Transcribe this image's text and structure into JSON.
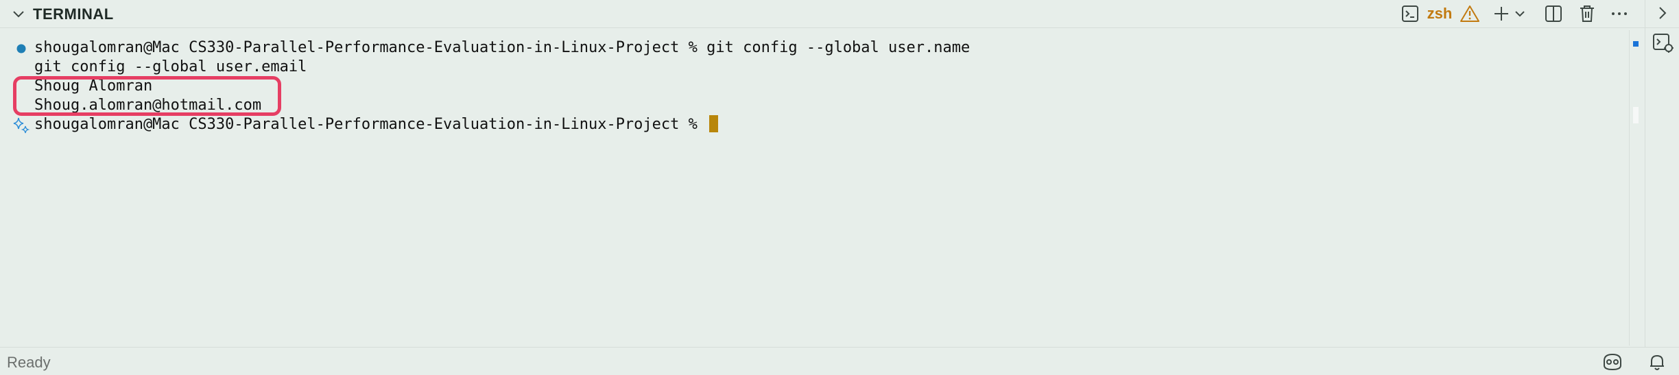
{
  "header": {
    "title": "TERMINAL",
    "shell_name": "zsh"
  },
  "terminal": {
    "lines": [
      {
        "text": "shougalomran@Mac CS330-Parallel-Performance-Evaluation-in-Linux-Project % git config --global user.name",
        "marker": "command-dot"
      },
      {
        "text": "git config --global user.email"
      },
      {
        "text": "Shoug Alomran"
      },
      {
        "text": "Shoug.alomran@hotmail.com"
      },
      {
        "text": "shougalomran@Mac CS330-Parallel-Performance-Evaluation-in-Linux-Project % ",
        "marker": "sparkle",
        "cursor": true
      }
    ]
  },
  "statusbar": {
    "status": "Ready"
  },
  "colors": {
    "background": "#e7eeea",
    "shell_accent": "#c27a10",
    "cursor": "#b8860b",
    "highlight_box": "#e63e63",
    "command_dot": "#1f7fb5",
    "sparkle": "#2f8fd8"
  },
  "icons": [
    "chevron-down-icon",
    "terminal-icon",
    "warning-icon",
    "plus-icon",
    "chevron-down-icon",
    "split-icon",
    "trash-icon",
    "more-icon",
    "chevron-right-icon",
    "terminal-debug-icon",
    "copilot-icon",
    "bell-icon",
    "sparkle-icon"
  ]
}
